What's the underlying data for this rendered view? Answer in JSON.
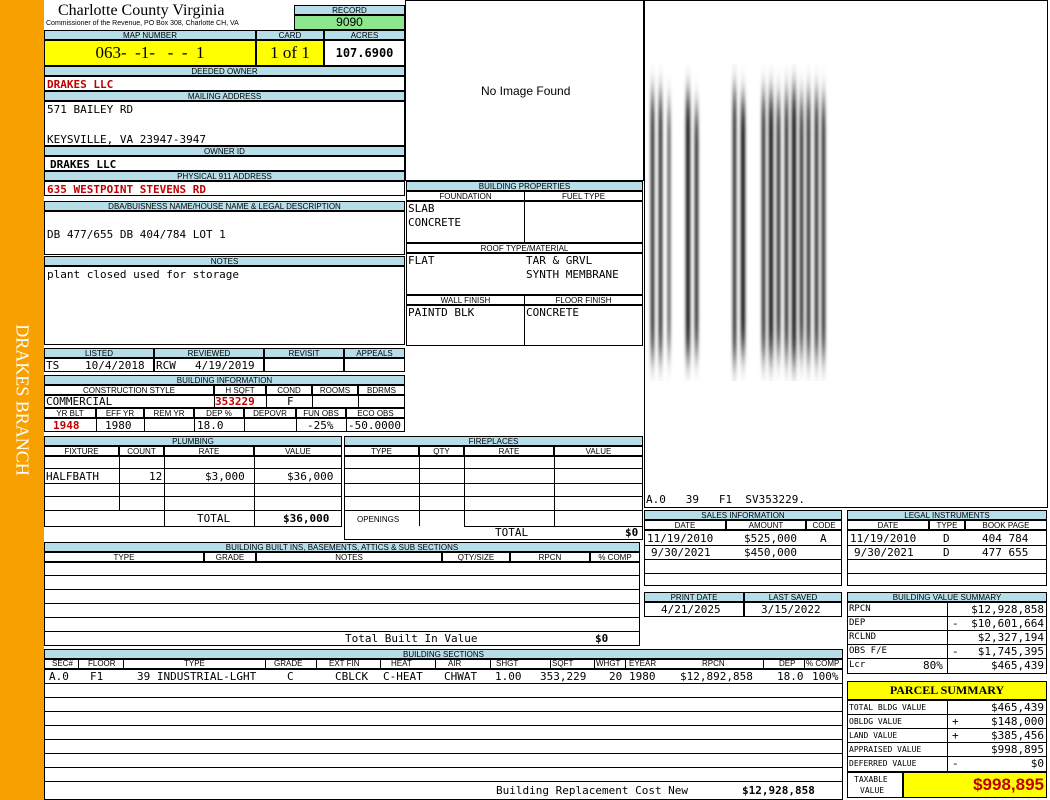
{
  "side_label": "DRAKES BRANCH",
  "header": {
    "county": "Charlotte County Virginia",
    "commissioner": "Commissioner of the Revenue, PO Box 308, Charlotte CH, VA",
    "record_label": "RECORD",
    "record_value": "9090",
    "map_number_label": "MAP NUMBER",
    "map_number": "063-  -1-   -  -  1",
    "card_label": "CARD",
    "card_value": "1 of 1",
    "acres_label": "ACRES",
    "acres_value": "107.6900"
  },
  "owner": {
    "deeded_owner_label": "DEEDED OWNER",
    "deeded_owner": "DRAKES LLC",
    "mailing_address_label": "MAILING ADDRESS",
    "mailing_line1": "571 BAILEY RD",
    "mailing_line2": "KEYSVILLE, VA 23947-3947",
    "owner_id_label": "OWNER ID",
    "owner_id": "DRAKES LLC",
    "physical_address_label": "PHYSICAL 911 ADDRESS",
    "physical_address": "635 WESTPOINT STEVENS RD",
    "dba_label": "DBA/BUISNESS NAME/HOUSE NAME & LEGAL DESCRIPTION",
    "dba_value": "DB 477/655 DB 404/784 LOT 1",
    "notes_label": "NOTES",
    "notes_value": "plant closed used for storage"
  },
  "image_placeholder": "No Image Found",
  "building_properties": {
    "title": "BUILDING PROPERTIES",
    "foundation_label": "FOUNDATION",
    "fuel_type_label": "FUEL TYPE",
    "foundation_1": "SLAB",
    "foundation_2": "CONCRETE",
    "roof_label": "ROOF TYPE/MATERIAL",
    "roof_1": "FLAT",
    "roof_2": "TAR & GRVL",
    "roof_3": "SYNTH MEMBRANE",
    "wall_label": "WALL FINISH",
    "floor_label": "FLOOR FINISH",
    "wall_value": "PAINTD BLK",
    "floor_value": "CONCRETE"
  },
  "sketch_caption": "A.0   39   F1  SV353229.",
  "review": {
    "listed_label": "LISTED",
    "reviewed_label": "REVIEWED",
    "revisit_label": "REVISIT",
    "appeals_label": "APPEALS",
    "listed_by": "TS",
    "listed_date": "10/4/2018",
    "reviewed_by": "RCW",
    "reviewed_date": "4/19/2019"
  },
  "building_info": {
    "title": "BUILDING INFORMATION",
    "construction_style_label": "CONSTRUCTION STYLE",
    "hsqft_label": "H SQFT",
    "cond_label": "COND",
    "rooms_label": "ROOMS",
    "bdrms_label": "BDRMS",
    "construction_style": "COMMERCIAL",
    "hsqft": "353229",
    "cond": "F",
    "yr_blt_label": "YR BLT",
    "eff_yr_label": "EFF YR",
    "rem_yr_label": "REM YR",
    "dep_pct_label": "DEP %",
    "depovr_label": "DEPOVR",
    "fun_obs_label": "FUN OBS",
    "eco_obs_label": "ECO OBS",
    "yr_blt": "1948",
    "eff_yr": "1980",
    "dep_pct": "18.0",
    "fun_obs": "-25%",
    "eco_obs": "-50.0000"
  },
  "plumbing": {
    "title": "PLUMBING",
    "headers": [
      "FIXTURE",
      "COUNT",
      "RATE",
      "VALUE"
    ],
    "fixture": "HALFBATH",
    "count": "12",
    "rate": "$3,000",
    "value": "$36,000",
    "total_label": "TOTAL",
    "total_value": "$36,000"
  },
  "fireplaces": {
    "title": "FIREPLACES",
    "headers": [
      "TYPE",
      "QTY",
      "RATE",
      "VALUE"
    ],
    "openings_label": "OPENINGS",
    "total_label": "TOTAL",
    "total_value": "$0"
  },
  "built_ins": {
    "title": "BUILDING BUILT INS, BASEMENTS, ATTICS & SUB SECTIONS",
    "headers": [
      "TYPE",
      "GRADE",
      "NOTES",
      "QTY/SIZE",
      "RPCN",
      "% COMP"
    ],
    "total_label": "Total Built In Value",
    "total_value": "$0"
  },
  "sales": {
    "title": "SALES INFORMATION",
    "headers": [
      "DATE",
      "AMOUNT",
      "CODE"
    ],
    "rows": [
      [
        "11/19/2010",
        "$525,000",
        "A"
      ],
      [
        "9/30/2021",
        "$450,000",
        ""
      ]
    ]
  },
  "legal": {
    "title": "LEGAL INSTRUMENTS",
    "headers": [
      "DATE",
      "TYPE",
      "BOOK PAGE"
    ],
    "rows": [
      [
        "11/19/2010",
        "D",
        "404 784"
      ],
      [
        "9/30/2021",
        "D",
        "477 655"
      ]
    ]
  },
  "print": {
    "print_date_label": "PRINT DATE",
    "last_saved_label": "LAST SAVED",
    "print_date": "4/21/2025",
    "last_saved": "3/15/2022"
  },
  "bvs": {
    "title": "BUILDING VALUE SUMMARY",
    "rows": [
      {
        "label": "RPCN",
        "sign": "",
        "value": "$12,928,858"
      },
      {
        "label": "DEP",
        "sign": "-",
        "value": "$10,601,664"
      },
      {
        "label": "RCLND",
        "sign": "",
        "value": "$2,327,194"
      },
      {
        "label": "OBS F/E",
        "sign": "-",
        "value": "$1,745,395"
      },
      {
        "label": "Lcr",
        "pct": "80%",
        "sign": "",
        "value": "$465,439"
      }
    ]
  },
  "building_sections": {
    "title": "BUILDING SECTIONS",
    "headers": [
      "SEC#",
      "FLOOR",
      "TYPE",
      "GRADE",
      "EXT FIN",
      "HEAT",
      "AIR",
      "SHGT",
      "SQFT",
      "WHGT",
      "EYEAR",
      "RPCN",
      "DEP",
      "% COMP"
    ],
    "row": [
      "A.0",
      "F1",
      "39 INDUSTRIAL-LGHT",
      "C",
      "CBLCK",
      "C-HEAT",
      "CHWAT",
      "1.00",
      "353,229",
      "20",
      "1980",
      "$12,892,858",
      "18.0",
      "100%"
    ],
    "brcn_label": "Building Replacement Cost New",
    "brcn_value": "$12,928,858"
  },
  "parcel_summary": {
    "title": "PARCEL SUMMARY",
    "rows": [
      {
        "label": "TOTAL BLDG VALUE",
        "sign": "",
        "value": "$465,439"
      },
      {
        "label": "OBLDG VALUE",
        "sign": "+",
        "value": "$148,000"
      },
      {
        "label": "LAND VALUE",
        "sign": "+",
        "value": "$385,456"
      },
      {
        "label": "APPRAISED VALUE",
        "sign": "",
        "value": "$998,895"
      },
      {
        "label": "DEFERRED VALUE",
        "sign": "-",
        "value": "$0"
      }
    ],
    "taxable_label_1": "TAXABLE",
    "taxable_label_2": "VALUE",
    "taxable_value": "$998,895"
  },
  "colors": {
    "side_band": "#f7a000",
    "header_blue": "#b7dde8",
    "record_green": "#8ee68e",
    "highlight_yellow": "#ffff00",
    "value_red": "#c00000"
  }
}
